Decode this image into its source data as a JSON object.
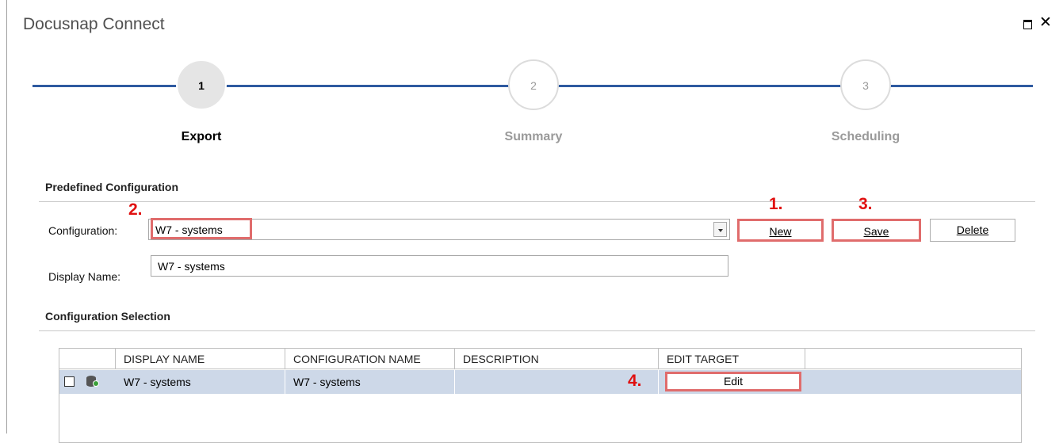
{
  "window": {
    "title": "Docusnap Connect"
  },
  "steps": [
    {
      "number": "1",
      "label": "Export"
    },
    {
      "number": "2",
      "label": "Summary"
    },
    {
      "number": "3",
      "label": "Scheduling"
    }
  ],
  "predefined": {
    "heading": "Predefined Configuration",
    "configuration_label": "Configuration:",
    "configuration_value": "W7 - systems",
    "display_name_label": "Display Name:",
    "display_name_value": "W7 - systems",
    "new_label": "New",
    "save_label": "Save",
    "delete_label": "Delete"
  },
  "annotations": {
    "a1": "1.",
    "a2": "2.",
    "a3": "3.",
    "a4": "4."
  },
  "selection": {
    "heading": "Configuration Selection",
    "columns": [
      "DISPLAY NAME",
      "CONFIGURATION NAME",
      "DESCRIPTION",
      "EDIT TARGET"
    ],
    "rows": [
      {
        "display_name": "W7 - systems",
        "configuration_name": "W7 - systems",
        "description": "",
        "edit_label": "Edit"
      }
    ]
  },
  "colors": {
    "step_line": "#2e5aa0",
    "highlight": "#e06c6c",
    "annotation": "#e01010",
    "row_selected": "#cdd8e8"
  }
}
